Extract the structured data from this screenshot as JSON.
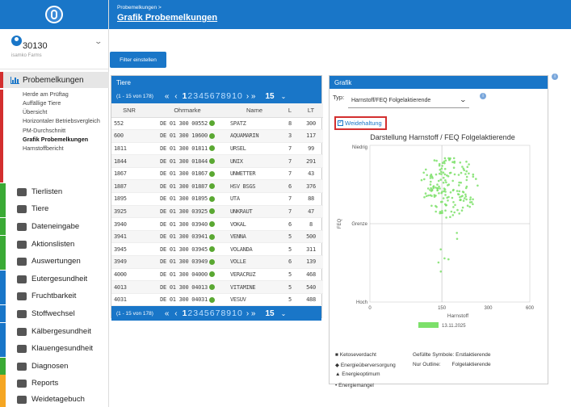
{
  "header": {
    "breadcrumb": "Probemelkungen >",
    "title": "Grafik Probemelkungen"
  },
  "account": {
    "id": "30130",
    "farm": "isamko Farms"
  },
  "sidebar": {
    "main_label": "Probemelkungen",
    "sub_items": [
      "Herde am Prüftag",
      "Auffällige Tiere",
      "Übersicht",
      "Horizontaler Betriebsvergleich",
      "PM-Durchschnitt",
      "Grafik Probemelkungen",
      "Harnstoffbericht"
    ],
    "items": [
      {
        "label": "Tierlisten",
        "color": "#3aaa35"
      },
      {
        "label": "Tiere",
        "color": "#3aaa35"
      },
      {
        "label": "Dateneingabe",
        "color": "#3aaa35"
      },
      {
        "label": "Aktionslisten",
        "color": "#3aaa35"
      },
      {
        "label": "Auswertungen",
        "color": "#3aaa35"
      },
      {
        "label": "Eutergesundheit",
        "color": "#1976c8"
      },
      {
        "label": "Fruchtbarkeit",
        "color": "#1976c8"
      },
      {
        "label": "Stoffwechsel",
        "color": "#1976c8"
      },
      {
        "label": "Kälbergesundheit",
        "color": "#1976c8"
      },
      {
        "label": "Klauengesundheit",
        "color": "#1976c8"
      },
      {
        "label": "Diagnosen",
        "color": "#3aaa35"
      },
      {
        "label": "Reports",
        "color": "#f5a623"
      },
      {
        "label": "Weidetagebuch",
        "color": "#f5a623"
      }
    ]
  },
  "filter_button": "Filter einstellen",
  "tiere": {
    "title": "Tiere",
    "pager": {
      "range": "(1 - 15 von 178)",
      "arrows_prev": "« ‹",
      "current": "1",
      "pages": "2345678910",
      "arrows_next": "› »",
      "page_size": "15"
    },
    "columns": [
      "SNR",
      "Ohrmarke",
      "Name",
      "L",
      "LT"
    ],
    "rows": [
      [
        "552",
        "DE 01 300 00552",
        "SPATZ",
        "8",
        "300"
      ],
      [
        "600",
        "DE 01 300 10600",
        "AQUAMARIN",
        "3",
        "117"
      ],
      [
        "1811",
        "DE 01 300 01811",
        "URSEL",
        "7",
        "99"
      ],
      [
        "1844",
        "DE 01 300 01844",
        "UNIX",
        "7",
        "291"
      ],
      [
        "1867",
        "DE 01 300 01867",
        "UNWETTER",
        "7",
        "43"
      ],
      [
        "1887",
        "DE 01 300 01887",
        "HSV BSGS",
        "6",
        "376"
      ],
      [
        "1895",
        "DE 01 300 01895",
        "UTA",
        "7",
        "88"
      ],
      [
        "3925",
        "DE 01 300 03925",
        "UNKRAUT",
        "7",
        "47"
      ],
      [
        "3940",
        "DE 01 300 03940",
        "VOKAL",
        "6",
        "8"
      ],
      [
        "3941",
        "DE 01 300 03941",
        "VENNA",
        "5",
        "500"
      ],
      [
        "3945",
        "DE 01 300 03945",
        "VOLANDA",
        "5",
        "311"
      ],
      [
        "3949",
        "DE 01 300 03949",
        "VOLLE",
        "6",
        "139"
      ],
      [
        "4000",
        "DE 01 300 04000",
        "VERACRUZ",
        "5",
        "468"
      ],
      [
        "4013",
        "DE 01 300 04013",
        "VITAMINE",
        "5",
        "540"
      ],
      [
        "4031",
        "DE 01 300 04031",
        "VESUV",
        "5",
        "488"
      ]
    ]
  },
  "grafik": {
    "title": "Grafik",
    "typ_label": "Typ:",
    "typ_value": "Harnstoff/FEQ Folgelaktierende",
    "checkbox_label": "Weidehaltung",
    "info_glyph": "i"
  },
  "chart_data": {
    "type": "scatter",
    "title": "Darstellung Harnstoff / FEQ Folgelaktierende",
    "xlabel": "Harnstoff",
    "ylabel": "FEQ",
    "xlim": [
      0,
      600
    ],
    "x_ticks": [
      "0",
      "150",
      "300",
      "600"
    ],
    "y_tick_labels": [
      "Niedrig",
      "Grenze",
      "Hoch"
    ],
    "legend_date": "13.11.2025",
    "color": "#7ce06a",
    "grid": true,
    "points_approx_count": 178
  },
  "legend": {
    "items": [
      "Ketoseverdacht",
      "Energieüberversorgung",
      "Energieoptimum",
      "Energiemangel"
    ],
    "symbols_label_1": "Gefüllte Symbole:",
    "symbols_value_1": "Erstlaktierende",
    "symbols_label_2": "Nur Outline:",
    "symbols_value_2": "Folgelaktierende"
  }
}
